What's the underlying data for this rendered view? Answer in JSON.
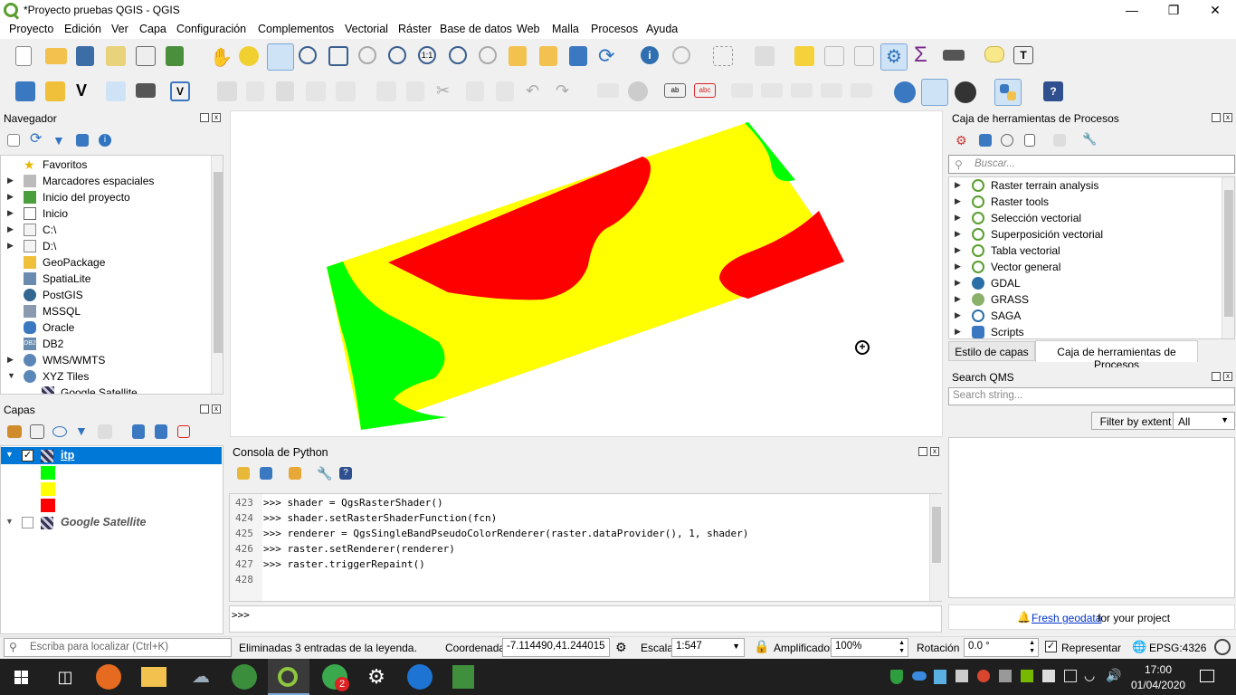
{
  "window": {
    "title": "*Proyecto pruebas QGIS - QGIS"
  },
  "menu": [
    "Proyecto",
    "Edición",
    "Ver",
    "Capa",
    "Configuración",
    "Complementos",
    "Vectorial",
    "Ráster",
    "Base de datos",
    "Web",
    "Malla",
    "Procesos",
    "Ayuda"
  ],
  "browser": {
    "title": "Navegador",
    "items": [
      "Favoritos",
      "Marcadores espaciales",
      "Inicio del proyecto",
      "Inicio",
      "C:\\",
      "D:\\",
      "GeoPackage",
      "SpatiaLite",
      "PostGIS",
      "MSSQL",
      "Oracle",
      "DB2",
      "WMS/WMTS",
      "XYZ Tiles",
      "Google Satellite"
    ]
  },
  "layers": {
    "title": "Capas",
    "raster": {
      "name": "itp",
      "classes": [
        "#00ff00",
        "#ffff00",
        "#ff0000"
      ]
    },
    "satellite": {
      "name": "Google Satellite"
    }
  },
  "console": {
    "title": "Consola de Python",
    "lines": [
      {
        "n": "423",
        "t": ">>> shader = QgsRasterShader()"
      },
      {
        "n": "424",
        "t": ">>> shader.setRasterShaderFunction(fcn)"
      },
      {
        "n": "425",
        "t": ">>> renderer = QgsSingleBandPseudoColorRenderer(raster.dataProvider(), 1, shader)"
      },
      {
        "n": "426",
        "t": ">>> raster.setRenderer(renderer)"
      },
      {
        "n": "427",
        "t": ">>> raster.triggerRepaint()"
      },
      {
        "n": "428",
        "t": ""
      }
    ],
    "prompt": ">>>"
  },
  "processing": {
    "title": "Caja de herramientas de Procesos",
    "search_placeholder": "Buscar...",
    "items": [
      "Raster terrain analysis",
      "Raster tools",
      "Selección vectorial",
      "Superposición vectorial",
      "Tabla vectorial",
      "Vector general",
      "GDAL",
      "GRASS",
      "SAGA",
      "Scripts"
    ],
    "tabs": [
      "Estilo de capas",
      "Caja de herramientas de Procesos"
    ]
  },
  "qms": {
    "title": "Search QMS",
    "search_placeholder": "Search string...",
    "filter_button": "Filter by extent",
    "filter_value": "All",
    "footer_link": "Fresh geodata",
    "footer_text": "for your project"
  },
  "status": {
    "locator_placeholder": "Escriba para localizar (Ctrl+K)",
    "message": "Eliminadas 3 entradas de la leyenda.",
    "coord_label": "Coordenada",
    "coord_value": "-7.114490,41.244015",
    "scale_label": "Escala",
    "scale_value": "1:547",
    "magnifier_label": "Amplificador",
    "magnifier_value": "100%",
    "rotation_label": "Rotación",
    "rotation_value": "0.0 °",
    "render_label": "Representar",
    "crs": "EPSG:4326"
  },
  "taskbar": {
    "time": "17:00",
    "date": "01/04/2020",
    "badge": "2"
  },
  "colors": {
    "green": "#00ff00",
    "yellow": "#ffff00",
    "red": "#ff0000",
    "selection": "#0078d7"
  }
}
